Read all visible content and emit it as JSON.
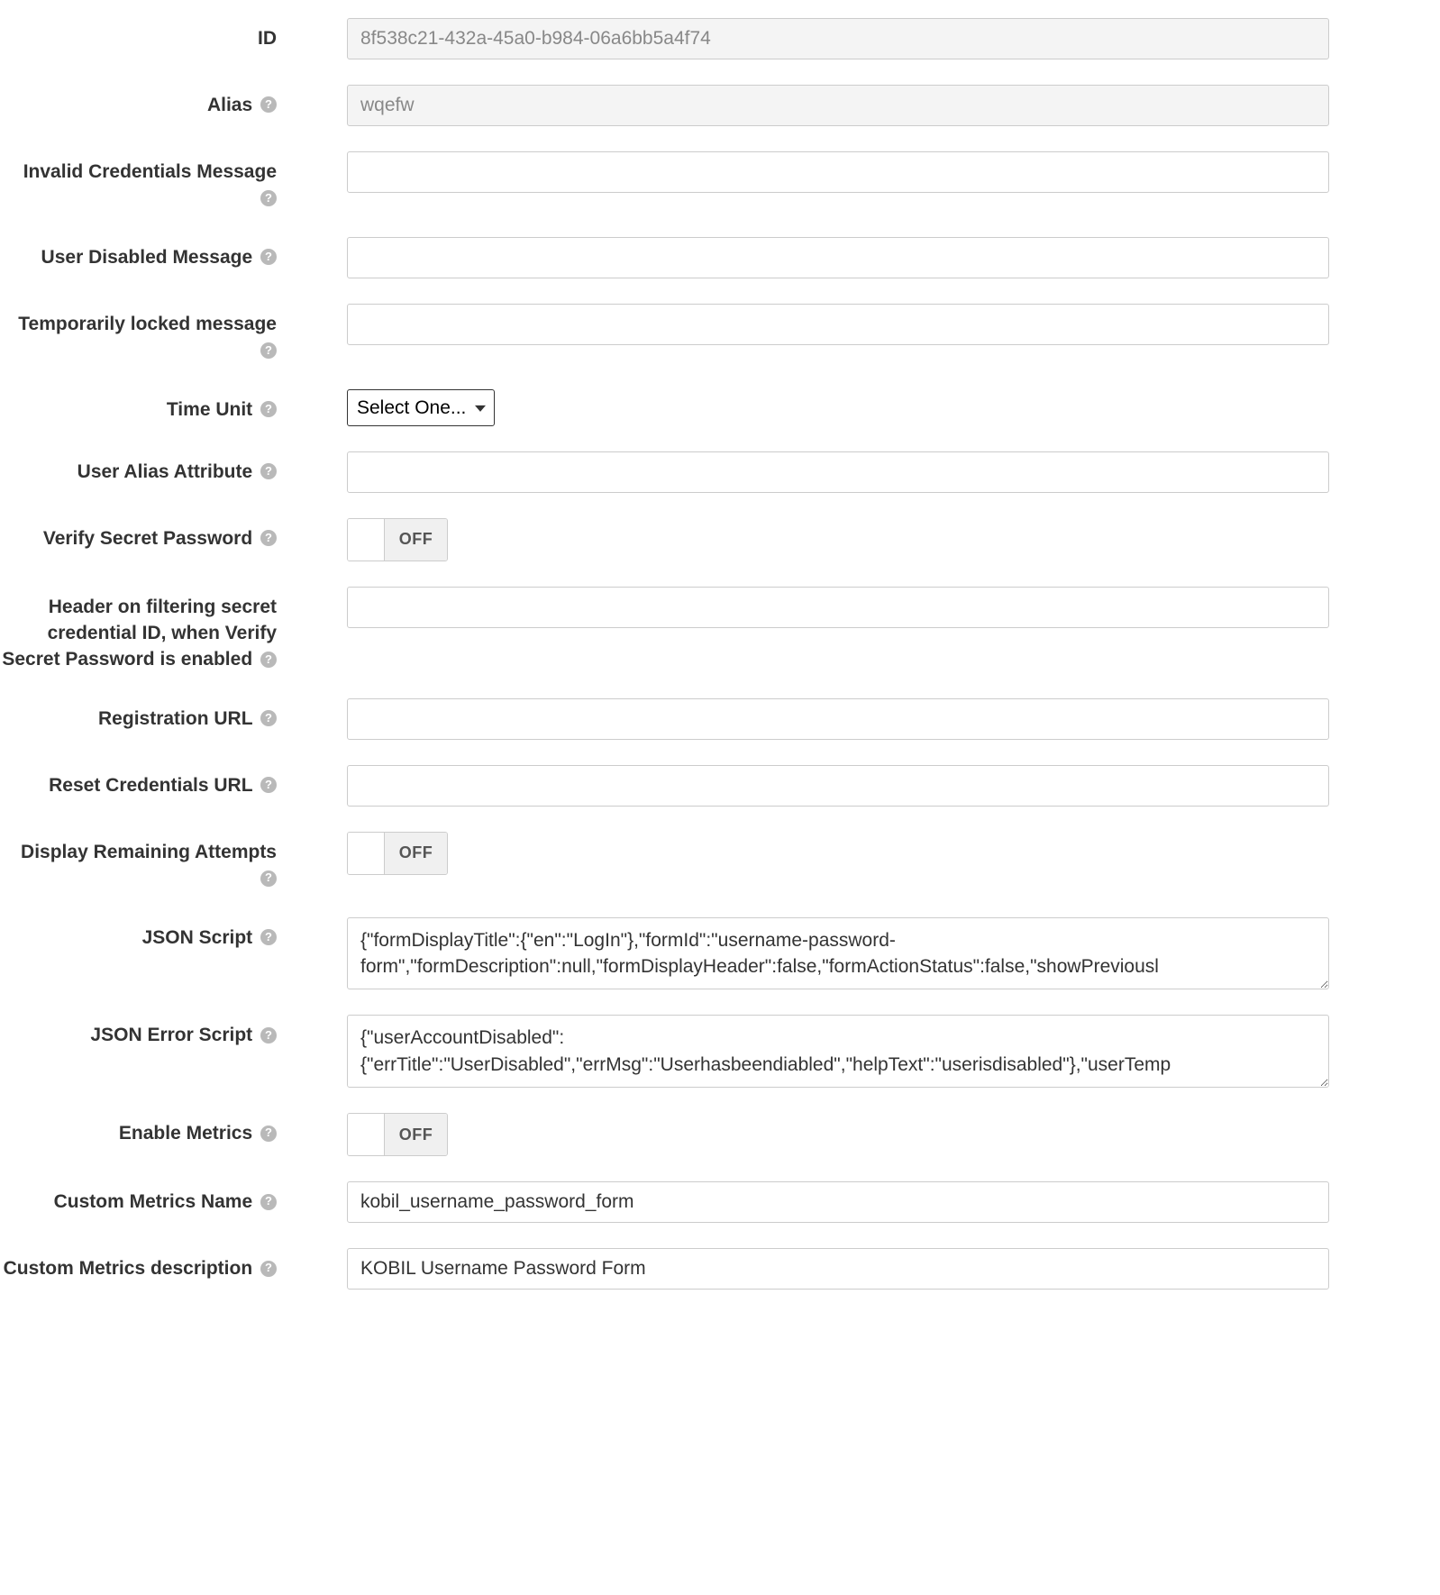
{
  "labels": {
    "id": "ID",
    "alias": "Alias",
    "invalid_credentials": "Invalid Credentials Message",
    "user_disabled": "User Disabled Message",
    "temporarily_locked": "Temporarily locked message",
    "time_unit": "Time Unit",
    "user_alias_attribute": "User Alias Attribute",
    "verify_secret_password": "Verify Secret Password",
    "header_secret_credential": "Header on filtering secret credential ID, when Verify Secret Password is enabled",
    "registration_url": "Registration URL",
    "reset_credentials_url": "Reset Credentials URL",
    "display_remaining_attempts": "Display Remaining Attempts",
    "json_script": "JSON Script",
    "json_error_script": "JSON Error Script",
    "enable_metrics": "Enable Metrics",
    "custom_metrics_name": "Custom Metrics Name",
    "custom_metrics_description": "Custom Metrics description"
  },
  "values": {
    "id": "8f538c21-432a-45a0-b984-06a6bb5a4f74",
    "alias": "wqefw",
    "invalid_credentials": "",
    "user_disabled": "",
    "temporarily_locked": "",
    "time_unit": "Select One...",
    "user_alias_attribute": "",
    "verify_secret_password_state": "OFF",
    "header_secret_credential": "",
    "registration_url": "",
    "reset_credentials_url": "",
    "display_remaining_attempts_state": "OFF",
    "json_script": "{\"formDisplayTitle\":{\"en\":\"LogIn\"},\"formId\":\"username-password-form\",\"formDescription\":null,\"formDisplayHeader\":false,\"formActionStatus\":false,\"showPreviousl",
    "json_error_script": "{\"userAccountDisabled\":{\"errTitle\":\"UserDisabled\",\"errMsg\":\"Userhasbeendiabled\",\"helpText\":\"userisdisabled\"},\"userTemp",
    "enable_metrics_state": "OFF",
    "custom_metrics_name": "kobil_username_password_form",
    "custom_metrics_description": "KOBIL Username Password Form"
  },
  "help_glyph": "?",
  "toggle_off_label": "OFF"
}
